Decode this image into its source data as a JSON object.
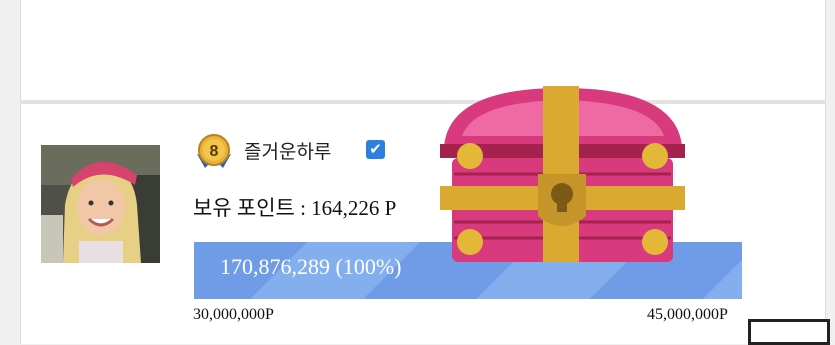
{
  "profile": {
    "rank_level": "8",
    "nickname": "즐거운하루",
    "verified_mark": "✔",
    "points_label": "보유 포인트 : 164,226 P"
  },
  "progress": {
    "label": "170,876,289 (100%)",
    "fraction": 1.0,
    "min_label": "30,000,000P",
    "max_label": "45,000,000P"
  },
  "icons": {
    "rank": "rank-medal-icon",
    "verified": "checkbox-checked-icon",
    "reward": "treasure-chest-icon"
  },
  "colors": {
    "progress": "#7aa6ea",
    "chest_body": "#d93a7d",
    "chest_band": "#d9a930",
    "verified": "#2d7fe0"
  }
}
